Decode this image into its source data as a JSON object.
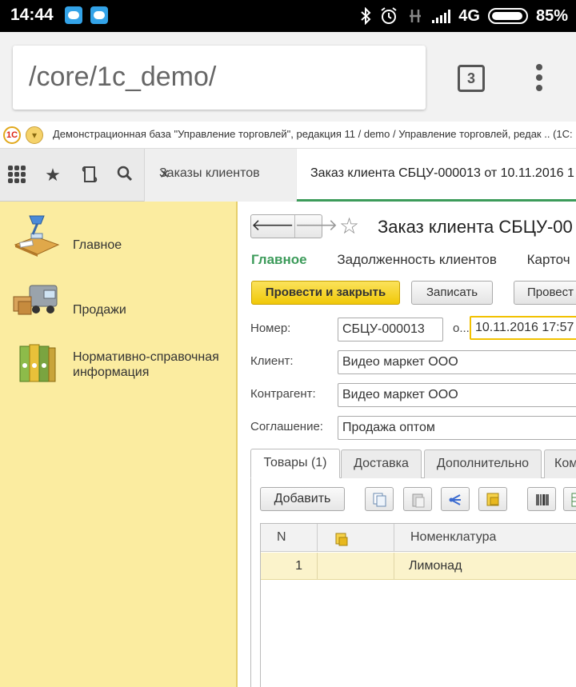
{
  "status_bar": {
    "time": "14:44",
    "network": "4G",
    "battery": "85%",
    "icons": [
      "cloud-app-icon",
      "cloud-app-icon",
      "bluetooth-icon",
      "alarm-icon",
      "data-off-icon",
      "signal-icon",
      "battery-icon"
    ]
  },
  "browser": {
    "url": "/core/1c_demo/",
    "tab_count": "3"
  },
  "app_strip": {
    "title": "Демонстрационная база \"Управление торговлей\", редакция 11 / demo / Управление торговлей, редак .. (1С:"
  },
  "toolbar_tabs": {
    "orders_tab": "Заказы клиентов",
    "active_tab": "Заказ клиента СБЦУ-000013 от 10.11.2016 1"
  },
  "sections": [
    {
      "label": "Главное",
      "icon": "desk-lamp-icon"
    },
    {
      "label": "Продажи",
      "icon": "delivery-truck-icon"
    },
    {
      "label": "Нормативно-справочная информация",
      "icon": "binders-icon"
    }
  ],
  "form": {
    "title": "Заказ клиента СБЦУ-00",
    "nav_links": [
      "Главное",
      "Задолженность клиентов",
      "Карточ"
    ],
    "buttons": {
      "post_close": "Провести и закрыть",
      "save": "Записать",
      "post": "Провест"
    },
    "fields": {
      "number_label": "Номер:",
      "number_value": "СБЦУ-000013",
      "date_label": "о...",
      "date_value": "10.11.2016 17:57",
      "client_label": "Клиент:",
      "client_value": "Видео маркет ООО",
      "contractor_label": "Контрагент:",
      "contractor_value": "Видео маркет ООО",
      "agreement_label": "Соглашение:",
      "agreement_value": "Продажа оптом"
    },
    "tabs": [
      "Товары (1)",
      "Доставка",
      "Дополнительно",
      "Ком"
    ],
    "goods": {
      "add_button": "Добавить",
      "columns": {
        "n": "N",
        "nomenclature": "Номенклатура"
      },
      "rows": [
        {
          "n": "1",
          "nomenclature": "Лимонад"
        }
      ]
    }
  },
  "colors": {
    "status_bar": "#000000",
    "side_panel": "#fbeca0",
    "accent_green": "#3c9b5a",
    "primary_button": "#f0c808",
    "selected_row": "#fbf3cb"
  }
}
